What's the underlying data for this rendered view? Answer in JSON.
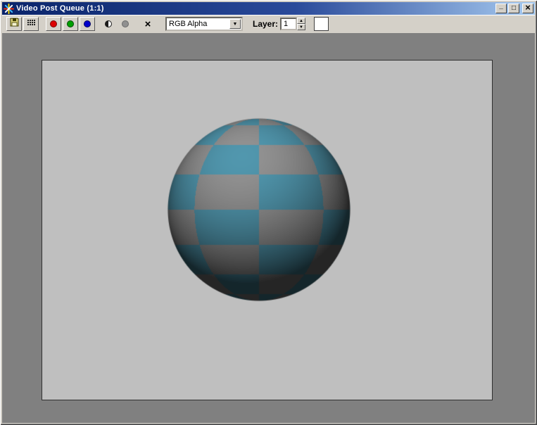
{
  "window": {
    "title": "Video Post Queue (1:1)",
    "minimize_glyph": "_",
    "maximize_glyph": "□",
    "close_glyph": "×"
  },
  "toolbar": {
    "channel_dropdown": {
      "value": "RGB Alpha",
      "arrow_glyph": "▼"
    },
    "layer": {
      "label": "Layer:",
      "value": "1",
      "up_glyph": "▲",
      "down_glyph": "▼"
    },
    "clear_glyph": "×",
    "channel_colors": {
      "red": "#dd0000",
      "green": "#00a000",
      "blue": "#0000cc",
      "alpha_gray": "#909090"
    }
  },
  "viewport": {
    "background_color": "#808080",
    "canvas_color": "#bfbfbf",
    "sphere": {
      "checker_color_teal": "#4e91a7",
      "checker_color_gray": "#8d8d8d",
      "lat_divisions": 8,
      "lon_divisions": 8,
      "ambient": 0.26,
      "diffuse": 0.78,
      "light_dir": [
        -0.18,
        0.58,
        0.79
      ]
    }
  },
  "colors": {
    "titlebar_gradient_start": "#0a246a",
    "titlebar_gradient_end": "#a6caf0",
    "chrome": "#d4d0c8"
  },
  "icons": {
    "app": "starburst-render-icon",
    "save": "floppy-disk-icon",
    "clone": "dotted-grid-icon",
    "mono": "half-filled-circle-icon"
  }
}
